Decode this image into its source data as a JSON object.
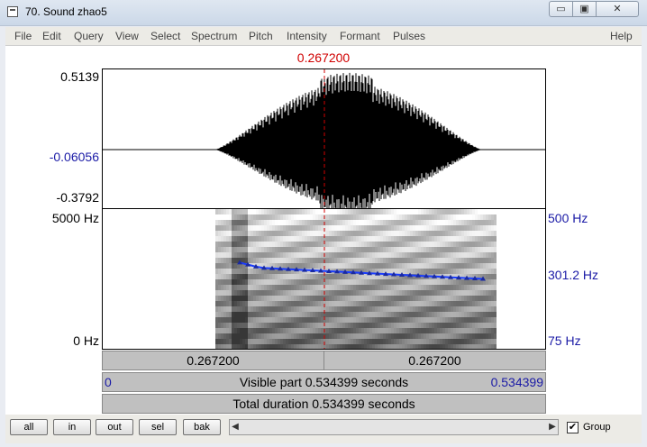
{
  "window": {
    "title": "70. Sound zhao5",
    "min_glyph": "▭",
    "max_glyph": "▣",
    "close_glyph": "✕"
  },
  "menu": [
    "File",
    "Edit",
    "Query",
    "View",
    "Select",
    "Spectrum",
    "Pitch",
    "Intensity",
    "Formant",
    "Pulses"
  ],
  "help": "Help",
  "cursor_time": "0.267200",
  "waveform": {
    "ymax": "0.5139",
    "ycursor": "-0.06056",
    "ymin": "-0.3792"
  },
  "spectrogram": {
    "fmax": "5000 Hz",
    "fmin": "0 Hz"
  },
  "pitch": {
    "top": "500 Hz",
    "current": "301.2 Hz",
    "bottom": "75 Hz"
  },
  "time_bar": {
    "left": "0.267200",
    "right": "0.267200"
  },
  "visible_bar": {
    "start": "0",
    "label": "Visible part 0.534399 seconds",
    "end": "0.534399"
  },
  "total_bar": {
    "label": "Total duration 0.534399 seconds"
  },
  "buttons": {
    "all": "all",
    "in": "in",
    "out": "out",
    "sel": "sel",
    "bak": "bak"
  },
  "group": {
    "label": "Group",
    "checked": true
  },
  "colors": {
    "cursor": "#d00000",
    "pitch": "#1a3cff",
    "axis_blue": "#1a1aa6"
  }
}
